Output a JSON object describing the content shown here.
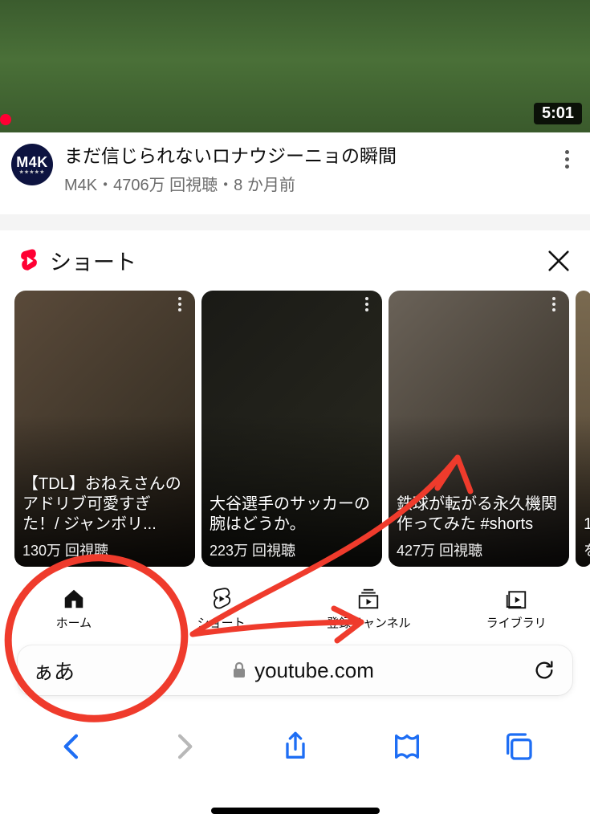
{
  "video": {
    "duration": "5:01",
    "channel_avatar_text": "M4K",
    "avatar_stars": "★★★★★",
    "title": "まだ信じられないロナウジーニョの瞬間",
    "meta_line": "M4K・4706万 回視聴・8 か月前"
  },
  "shorts": {
    "section_label": "ショート",
    "items": [
      {
        "title": "【TDL】おねえさんのアドリブ可愛すぎた！/ ジャンボリ...",
        "views": "130万 回視聴"
      },
      {
        "title": "大谷選手のサッカーの腕はどうか。",
        "views": "223万 回視聴"
      },
      {
        "title": "鉄球が転がる永久機関作ってみた #shorts",
        "views": "427万 回視聴"
      },
      {
        "title": "1",
        "views": "を"
      }
    ]
  },
  "nav": {
    "home": "ホーム",
    "shorts": "ショート",
    "subs": "登録チャンネル",
    "library": "ライブラリ"
  },
  "browser": {
    "aa_label": "ぁあ",
    "url": "youtube.com"
  }
}
